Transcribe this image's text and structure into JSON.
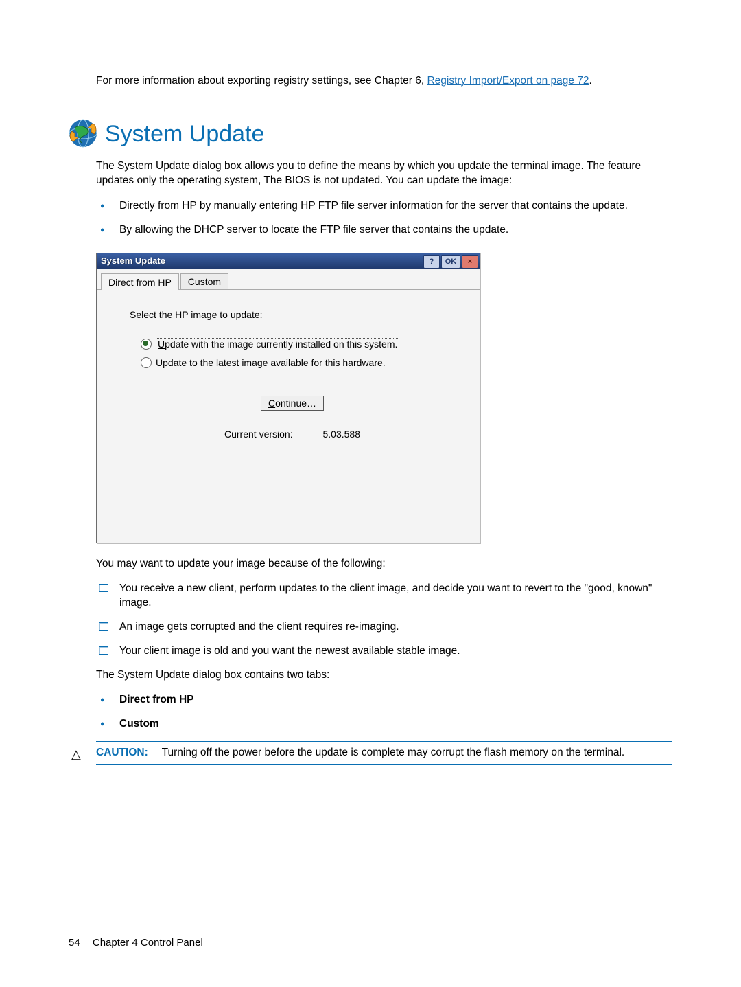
{
  "intro": {
    "pre_link_text": "For more information about exporting registry settings, see Chapter 6, ",
    "link_text": "Registry Import/Export on page 72",
    "post_link_text": "."
  },
  "heading": "System Update",
  "para1": "The System Update dialog box allows you to define the means by which you update the terminal image. The feature updates only the operating system, The BIOS is not updated. You can update the image:",
  "bullets_top": [
    "Directly from HP by manually entering HP FTP file server information for the server that contains the update.",
    "By allowing the DHCP server to locate the FTP file server that contains the update."
  ],
  "dialog": {
    "title": "System Update",
    "help_label": "?",
    "ok_label": "OK",
    "close_label": "×",
    "tabs": {
      "direct": "Direct from HP",
      "custom": "Custom"
    },
    "prompt": "Select the HP image to update:",
    "radio1": {
      "pre": "",
      "underline": "U",
      "rest": "pdate with the image currently installed on this system.",
      "checked": true
    },
    "radio2": {
      "pre": "Up",
      "underline": "d",
      "rest": "ate to the latest image available for this hardware.",
      "checked": false
    },
    "continue": {
      "underline": "C",
      "rest": "ontinue…"
    },
    "version_label": "Current version:",
    "version_value": "5.03.588"
  },
  "para2": "You may want to update your image because of the following:",
  "check_items": [
    "You receive a new client, perform updates to the client image, and decide you want to revert to the \"good, known\" image.",
    "An image gets corrupted and the client requires re-imaging.",
    "Your client image is old and you want the newest available stable image."
  ],
  "para3": "The System Update dialog box contains two tabs:",
  "tab_names": [
    "Direct from HP",
    "Custom"
  ],
  "caution": {
    "label": "CAUTION:",
    "text": "Turning off the power before the update is complete may corrupt the flash memory on the terminal."
  },
  "footer": {
    "page_number": "54",
    "chapter": "Chapter 4   Control Panel"
  }
}
